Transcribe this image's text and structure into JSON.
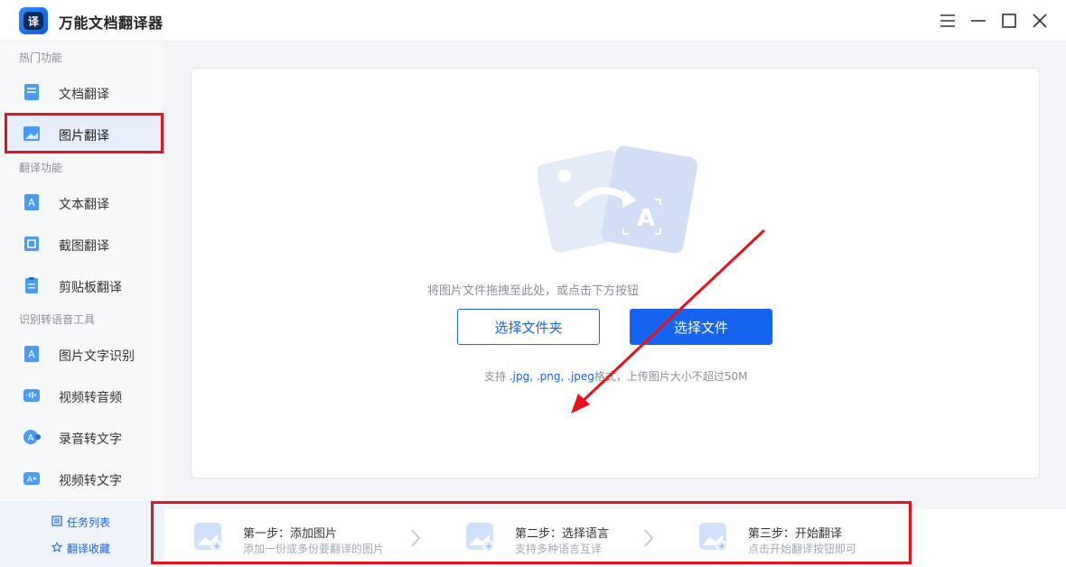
{
  "app": {
    "title": "万能文档翻译器",
    "logo_text": "译"
  },
  "window_controls": [
    "menu-icon",
    "minimize-icon",
    "maximize-icon",
    "close-icon"
  ],
  "sidebar": {
    "sections": [
      {
        "title": "热门功能"
      },
      {
        "title": "翻译功能"
      },
      {
        "title": "识别转语音工具"
      }
    ],
    "items": [
      {
        "label": "文档翻译",
        "icon": "document-icon"
      },
      {
        "label": "图片翻译",
        "icon": "image-icon",
        "active": true
      },
      {
        "label": "文本翻译",
        "icon": "text-icon"
      },
      {
        "label": "截图翻译",
        "icon": "screenshot-icon"
      },
      {
        "label": "剪贴板翻译",
        "icon": "clipboard-icon"
      },
      {
        "label": "图片文字识别",
        "icon": "ocr-icon"
      },
      {
        "label": "视频转音频",
        "icon": "video-audio-icon"
      },
      {
        "label": "录音转文字",
        "icon": "recording-icon"
      },
      {
        "label": "视频转文字",
        "icon": "video-text-icon"
      }
    ],
    "bottom_links": [
      {
        "label": "任务列表",
        "icon": "list-icon"
      },
      {
        "label": "翻译收藏",
        "icon": "star-icon"
      }
    ]
  },
  "upload": {
    "hint": "将图片文件拖拽至此处，或点击下方按钮",
    "select_folder": "选择文件夹",
    "select_file": "选择文件",
    "support_prefix": "支持",
    "support_formats": ".jpg, .png, .jpeg",
    "support_suffix": "格式，上传图片大小不超过50M"
  },
  "steps": [
    {
      "title": "第一步：添加图片",
      "subtitle": "添加一份或多份要翻译的图片"
    },
    {
      "title": "第二步：选择语言",
      "subtitle": "支持多种语言互译"
    },
    {
      "title": "第三步：开始翻译",
      "subtitle": "点击开始翻译按钮即可"
    }
  ],
  "colors": {
    "accent": "#1464f0",
    "highlight": "#e8111b",
    "sidebar_bg": "#f7f8fa"
  }
}
